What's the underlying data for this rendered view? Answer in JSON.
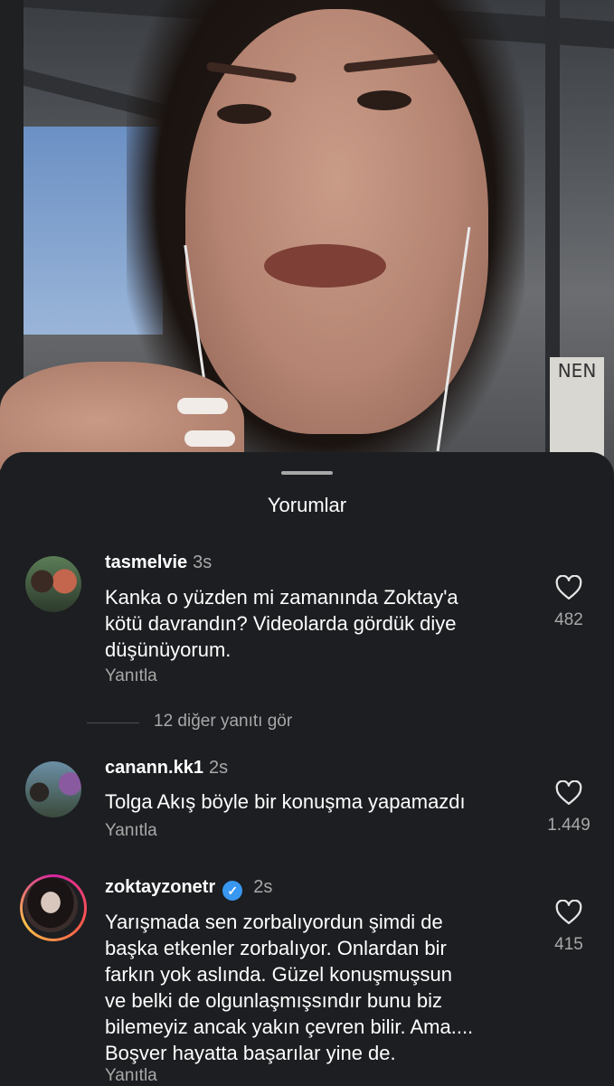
{
  "sheet": {
    "title": "Yorumlar"
  },
  "video": {
    "sign_text": "NEN"
  },
  "comments": [
    {
      "username": "tasmelvie",
      "time": "3s",
      "text_lines": [
        "Kanka o yüzden mi zamanında Zoktay'a",
        "kötü davrandın? Videolarda gördük diye",
        "düşünüyorum."
      ],
      "reply_label": "Yanıtla",
      "likes": "482",
      "verified": false
    },
    {
      "username": "canann.kk1",
      "time": "2s",
      "text_lines": [
        "Tolga Akış böyle bir konuşma yapamazdı"
      ],
      "reply_label": "Yanıtla",
      "likes": "1.449",
      "verified": false
    },
    {
      "username": "zoktayzonetr",
      "time": "2s",
      "text_lines": [
        "Yarışmada sen zorbalıyordun şimdi de",
        "başka etkenler zorbalıyor. Onlardan bir",
        "farkın yok aslında. Güzel konuşmuşsun",
        "ve belki de olgunlaşmışsındır bunu biz",
        "bilemeyiz ancak yakın çevren bilir. Ama....",
        "Boşver hayatta başarılar yine de."
      ],
      "reply_label": "Yanıtla",
      "likes": "415",
      "verified": true,
      "story_ring": true
    }
  ],
  "view_more_replies": "12 diğer yanıtı gör",
  "icons": {
    "like": "heart-icon",
    "verified": "verified-badge-icon"
  },
  "colors": {
    "background": "#1c1e21",
    "text": "#ffffff",
    "secondary_text": "#a8a8a8",
    "verified": "#3897f0"
  }
}
